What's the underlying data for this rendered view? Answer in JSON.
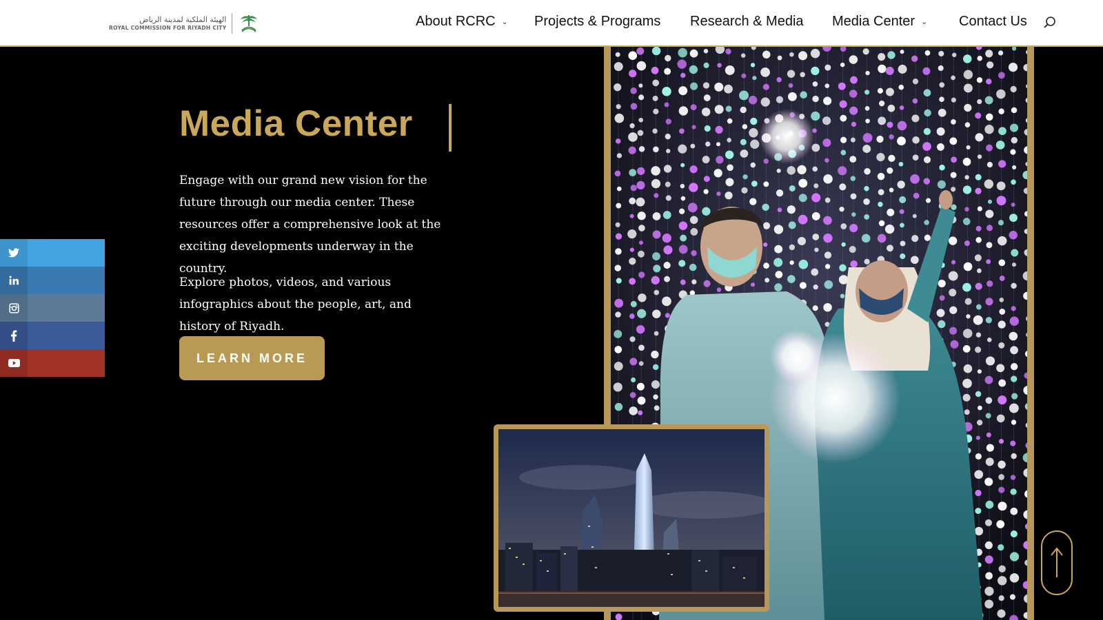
{
  "header": {
    "logo": {
      "arabic": "الهيئة الملكية لمدينة الرياض",
      "english": "ROYAL COMMISSION FOR RIYADH CITY"
    },
    "nav": [
      {
        "label": "About RCRC",
        "has_dropdown": true
      },
      {
        "label": "Projects & Programs",
        "has_dropdown": false
      },
      {
        "label": "Research & Media",
        "has_dropdown": false
      },
      {
        "label": "Media Center",
        "has_dropdown": true
      },
      {
        "label": "Contact Us",
        "has_dropdown": false
      }
    ],
    "search_icon": "search-icon"
  },
  "hero": {
    "title": "Media Center",
    "paragraph1": " Engage with our grand new vision for the future through our media center. These resources offer a comprehensive look at the exciting developments underway in the country.",
    "paragraph2": "Explore photos, videos, and various infographics about the people, art, and history of Riyadh.",
    "button_label": "LEARN MORE"
  },
  "social": [
    {
      "icon": "twitter-icon",
      "color": "#44a4e2"
    },
    {
      "icon": "linkedin-icon",
      "color": "#3b79b1"
    },
    {
      "icon": "instagram-icon",
      "color": "#5d7a98"
    },
    {
      "icon": "facebook-icon",
      "color": "#3b5a99"
    },
    {
      "icon": "youtube-icon",
      "color": "#a33226"
    }
  ],
  "images": {
    "main": "people-with-light-installation-photo",
    "secondary": "riyadh-skyline-night-photo"
  },
  "colors": {
    "gold": "#c9a85a",
    "background": "#000000",
    "header": "#ffffff"
  },
  "scroll_top_icon": "arrow-up-icon"
}
